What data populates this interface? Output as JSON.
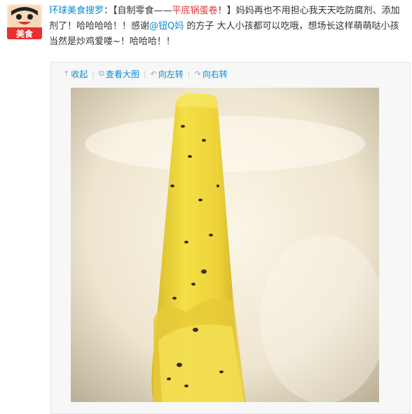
{
  "post": {
    "author": "环球美食搜罗",
    "colon": "：",
    "text_1": "【自制零食——",
    "highlight": "平底锅蛋卷",
    "text_2": "！】妈妈再也不用担心我天天吃防腐剂、添加剂了！哈哈哈哈！！感谢",
    "mention": "@钮Q妈",
    "text_3": " 的方子 大人小孩都可以吃哦，想场长这样萌萌哒小孩当然是炒鸡爱喽~！哈哈哈！！"
  },
  "avatar": {
    "badge": "美食"
  },
  "toolbar": {
    "collapse_icon": "⇡",
    "collapse": "收起",
    "view_large_icon": "⧉",
    "view_large": "查看大图",
    "rotate_left_icon": "↶",
    "rotate_left": "向左转",
    "rotate_right_icon": "↷",
    "rotate_right": "向右转",
    "sep": "|"
  },
  "colors": {
    "link": "#0a8cd2",
    "highlight": "#e53333",
    "avatar_badge": "#e8302f",
    "roll": "#f1dd3a"
  },
  "icons": [
    "avatar-logo",
    "collapse-icon",
    "view-large-icon",
    "rotate-left-icon",
    "rotate-right-icon"
  ]
}
